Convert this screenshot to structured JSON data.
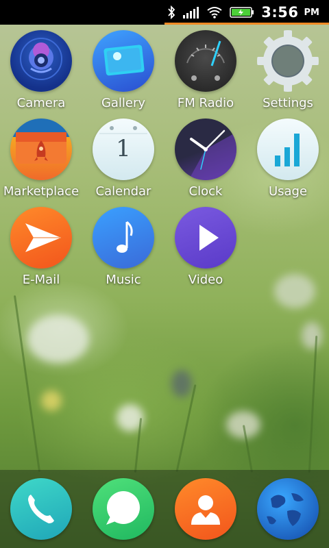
{
  "status_bar": {
    "time": "3:56",
    "ampm": "PM",
    "icons": [
      "bluetooth-icon",
      "signal-icon",
      "wifi-icon",
      "battery-charging-icon"
    ]
  },
  "apps": [
    {
      "label": "Camera",
      "icon": "camera-icon"
    },
    {
      "label": "Gallery",
      "icon": "gallery-icon"
    },
    {
      "label": "FM Radio",
      "icon": "fm-radio-icon"
    },
    {
      "label": "Settings",
      "icon": "gear-icon"
    },
    {
      "label": "Marketplace",
      "icon": "marketplace-icon"
    },
    {
      "label": "Calendar",
      "icon": "calendar-icon"
    },
    {
      "label": "Clock",
      "icon": "clock-icon"
    },
    {
      "label": "Usage",
      "icon": "usage-icon"
    },
    {
      "label": "E-Mail",
      "icon": "email-icon"
    },
    {
      "label": "Music",
      "icon": "music-icon"
    },
    {
      "label": "Video",
      "icon": "video-icon"
    }
  ],
  "calendar_day": "1",
  "dock": [
    {
      "icon": "phone-icon"
    },
    {
      "icon": "messages-icon"
    },
    {
      "icon": "contacts-icon"
    },
    {
      "icon": "browser-icon"
    }
  ]
}
